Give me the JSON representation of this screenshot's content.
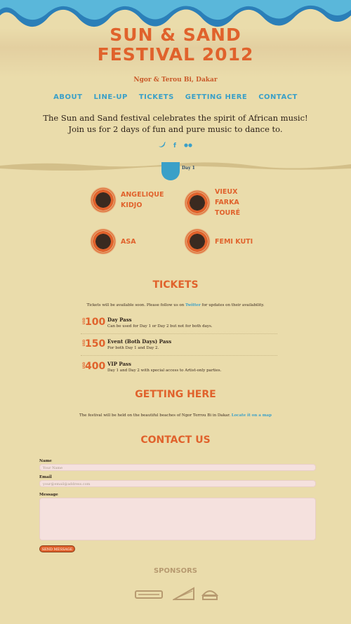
{
  "header": {
    "title_line1": "SUN & SAND",
    "title_line2": "FESTIVAL 2012",
    "location": "Ngor & Terou Bi, Dakar"
  },
  "nav": {
    "items": [
      "ABOUT",
      "LINE-UP",
      "TICKETS",
      "GETTING HERE",
      "CONTACT"
    ]
  },
  "intro": "The Sun and Sand festival celebrates the spirit of African music! Join us for 2 days of fun and pure music to dance to.",
  "social": {
    "twitter": "twitter-icon",
    "facebook": "f",
    "flickr": "flickr-icon"
  },
  "lineup": {
    "day_label": "Day 1",
    "artists": [
      {
        "line1": "ANGELIQUE",
        "line2": "KIDJO"
      },
      {
        "line1": "VIEUX FARKA",
        "line2": "TOURÉ"
      },
      {
        "line1": "ASA",
        "line2": ""
      },
      {
        "line1": "FEMI KUTI",
        "line2": ""
      }
    ]
  },
  "tickets": {
    "title": "TICKETS",
    "note_prefix": "Tickets will be available soon. Please follow us on ",
    "note_link": "Twitter",
    "note_suffix": " for updates on their availability.",
    "currency": "USD",
    "items": [
      {
        "price": "100",
        "name": "Day Pass",
        "desc": "Can be used for Day 1 or Day 2 but not for both days."
      },
      {
        "price": "150",
        "name": "Event (Both Days) Pass",
        "desc": "For both Day 1 and Day 2."
      },
      {
        "price": "400",
        "name": "VIP Pass",
        "desc": "Day 1 and Day 2 with special access to Artist-only parties."
      }
    ]
  },
  "getting_here": {
    "title": "GETTING HERE",
    "text": "The festival will be held on the beautiful beaches of Ngor Terrou Bi in Dakar.",
    "link": "Locate it on a map"
  },
  "contact": {
    "title": "CONTACT US",
    "name_label": "Name",
    "name_placeholder": "Your Name",
    "email_label": "Email",
    "email_placeholder": "your@email@address.com",
    "message_label": "Message",
    "send_label": "SEND MESSAGE"
  },
  "sponsors": {
    "title": "SPONSORS"
  },
  "colors": {
    "accent": "#e0622c",
    "link": "#3aa0c8",
    "background": "#eadcab"
  }
}
